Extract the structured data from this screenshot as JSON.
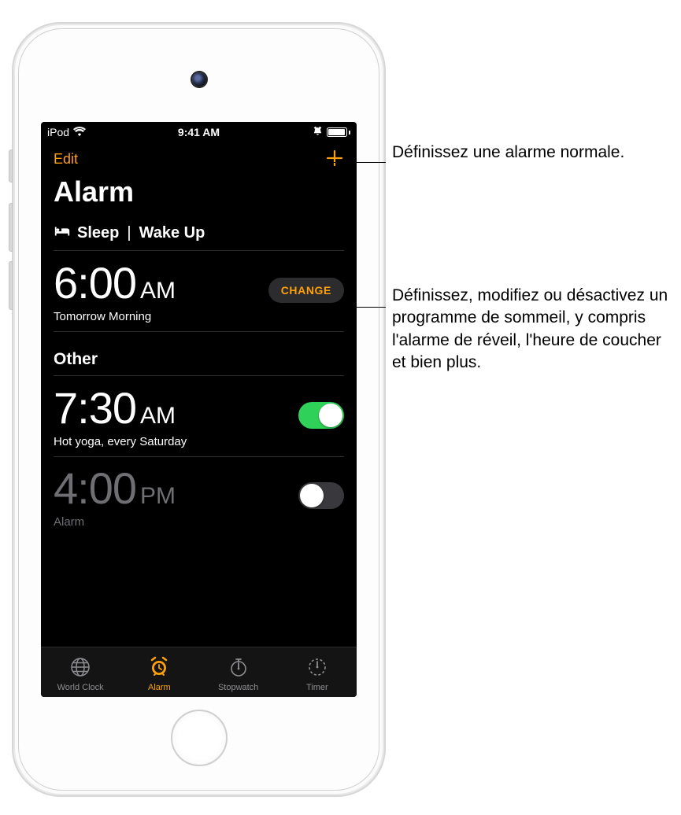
{
  "status": {
    "carrier": "iPod",
    "time": "9:41 AM"
  },
  "nav": {
    "edit": "Edit"
  },
  "title": "Alarm",
  "sleep_section": {
    "label_a": "Sleep",
    "label_b": "Wake Up",
    "time": "6:00",
    "ampm": "AM",
    "subtitle": "Tomorrow Morning",
    "change_label": "CHANGE"
  },
  "other_section": {
    "header": "Other",
    "alarms": [
      {
        "time": "7:30",
        "ampm": "AM",
        "subtitle": "Hot yoga, every Saturday",
        "on": true
      },
      {
        "time": "4:00",
        "ampm": "PM",
        "subtitle": "Alarm",
        "on": false
      }
    ]
  },
  "tabs": {
    "world": "World Clock",
    "alarm": "Alarm",
    "stopwatch": "Stopwatch",
    "timer": "Timer"
  },
  "callouts": {
    "add": "Définissez une alarme normale.",
    "change": "Définissez, modifiez ou désactivez un programme de sommeil, y compris l'alarme de réveil, l'heure de coucher et bien plus."
  }
}
